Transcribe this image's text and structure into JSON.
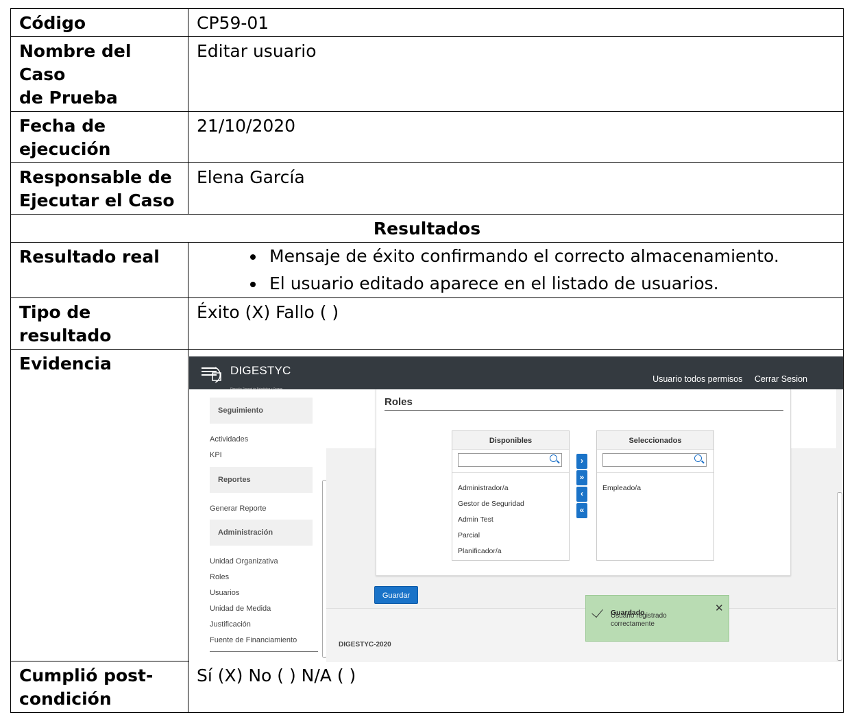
{
  "rows": {
    "codigo": {
      "label": "Código",
      "value": "CP59-01"
    },
    "nombre": {
      "label_1": "Nombre del Caso",
      "label_2": "de Prueba",
      "value": "Editar usuario"
    },
    "fecha": {
      "label_1": "Fecha de",
      "label_2": "ejecución",
      "value": "21/10/2020"
    },
    "responsable": {
      "label_1": "Responsable de",
      "label_2": "Ejecutar el Caso",
      "value": "Elena García"
    },
    "resultados_header": "Resultados",
    "resultado_real": {
      "label": "Resultado real",
      "items": [
        "Mensaje de éxito confirmando el correcto almacenamiento.",
        "El usuario editado aparece en el listado de usuarios."
      ]
    },
    "tipo": {
      "label": "Tipo de resultado",
      "value": "Éxito (X) Fallo ( )"
    },
    "evidencia": {
      "label": "Evidencia"
    },
    "cumplio": {
      "label_1": "Cumplió post-",
      "label_2": "condición",
      "value": "Sí (X) No ( )  N/A ( )"
    }
  },
  "screenshot": {
    "brand": "DIGESTYC",
    "brand_sub": "Dirección General de Estadística y Censos",
    "user_link": "Usuario todos permisos",
    "logout_link": "Cerrar Sesion",
    "sidebar": {
      "seguimiento": "Seguimiento",
      "actividades": "Actividades",
      "kpi": "KPI",
      "reportes": "Reportes",
      "generar_reporte": "Generar Reporte",
      "administracion": "Administración",
      "unidad_organizativa": "Unidad Organizativa",
      "roles": "Roles",
      "usuarios": "Usuarios",
      "unidad_medida": "Unidad de Medida",
      "justificacion": "Justificación",
      "fuente": "Fuente de Financiamiento"
    },
    "card_title": "Roles",
    "disponibles": {
      "header": "Disponibles",
      "items": [
        "Administrador/a",
        "Gestor de Seguridad",
        "Admin Test",
        "Parcial",
        "Planificador/a"
      ]
    },
    "seleccionados": {
      "header": "Seleccionados",
      "items": [
        "Empleado/a"
      ]
    },
    "move_buttons": [
      "›",
      "»",
      "‹",
      "«"
    ],
    "save_label": "Guardar",
    "toast": {
      "title": "Guardado",
      "message": "Usuario registrado correctamente"
    },
    "footer": "DIGESTYC-2020"
  }
}
